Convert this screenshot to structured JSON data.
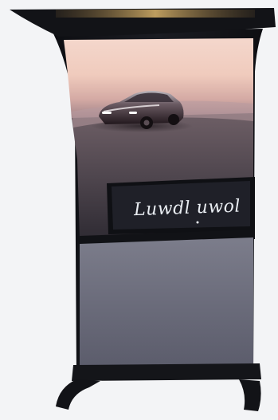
{
  "display": {
    "signature_text": "Luwdl uwol"
  },
  "colors": {
    "background": "#f3f4f6",
    "frame": "#15161a",
    "top_glow": "#ffd27a",
    "sky_top": "#f2c8b8",
    "ground": "#5a5158",
    "lower_panel": "#6f7080",
    "car_body": "#2b1f25"
  },
  "icons": {
    "signage": "car-advert-kiosk"
  }
}
